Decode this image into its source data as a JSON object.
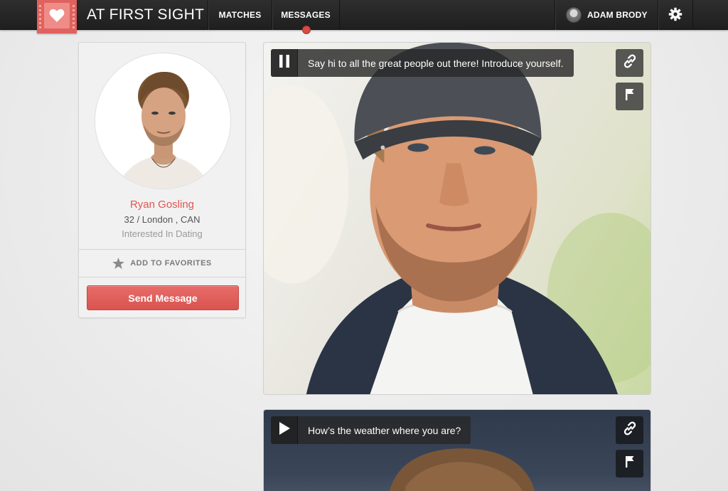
{
  "app": {
    "brand": "AT FIRST SIGHT"
  },
  "nav": {
    "matches_label": "MATCHES",
    "messages_label": "MESSAGES",
    "user_name": "ADAM BRODY"
  },
  "profile": {
    "name": "Ryan Gosling",
    "meta": "32 / London , CAN",
    "interest": "Interested In Dating",
    "favorites_label": "ADD TO FAVORITES",
    "send_message_label": "Send Message"
  },
  "videos": [
    {
      "caption": "Say hi to all the great people out there! Introduce yourself.",
      "state": "playing"
    },
    {
      "caption": "How’s the weather where you are?",
      "state": "paused"
    }
  ],
  "colors": {
    "accent": "#e0625f",
    "name_text": "#dd5752",
    "topbar": "#252525",
    "notification_dot": "#d94a45"
  },
  "icons": {
    "logo": "heart-film-icon",
    "settings": "gear-icon",
    "favorite": "star-icon",
    "pause": "pause-icon",
    "play": "play-icon",
    "link": "link-icon",
    "report": "flag-icon"
  }
}
